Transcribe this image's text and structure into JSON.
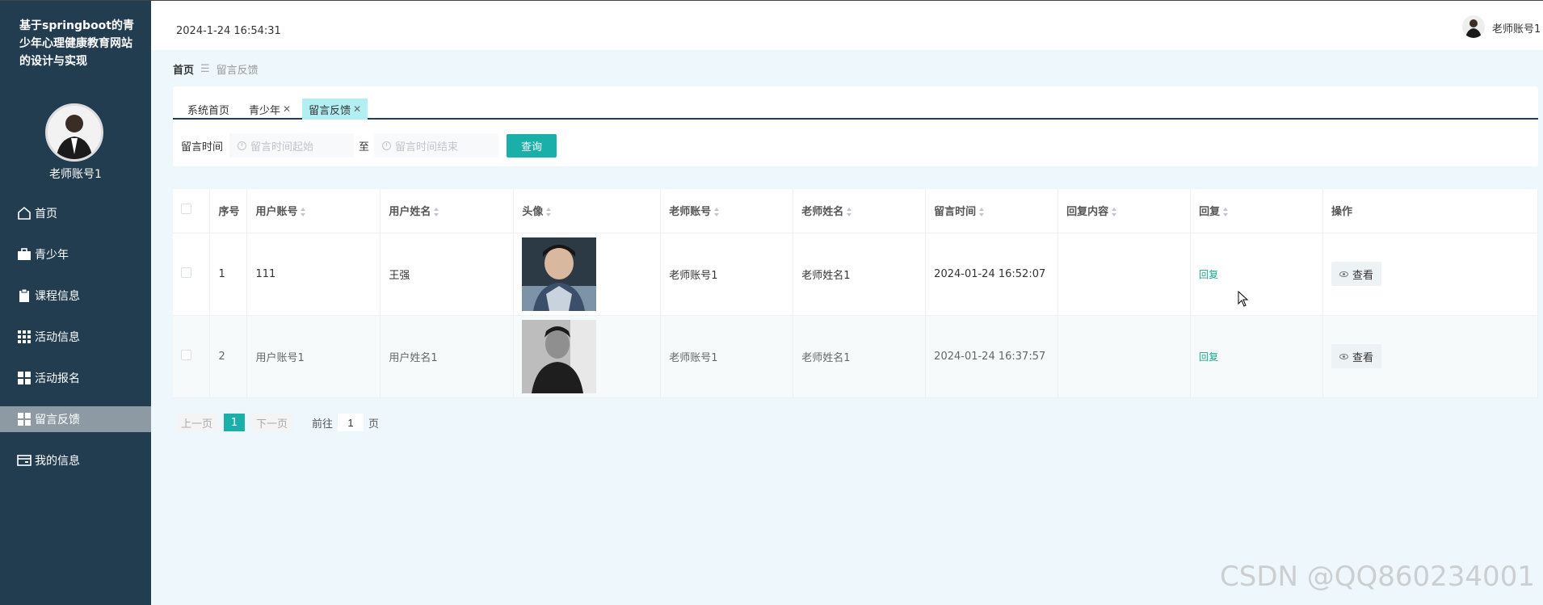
{
  "site": {
    "title": "基于springboot的青少年心理健康教育网站的设计与实现"
  },
  "profile": {
    "name": "老师账号1"
  },
  "menu": [
    {
      "label": "首页",
      "icon": "home-icon"
    },
    {
      "label": "青少年",
      "icon": "briefcase-icon"
    },
    {
      "label": "课程信息",
      "icon": "clipboard-icon"
    },
    {
      "label": "活动信息",
      "icon": "grid-icon"
    },
    {
      "label": "活动报名",
      "icon": "grid-four-icon"
    },
    {
      "label": "留言反馈",
      "icon": "grid-four-icon",
      "active": true
    },
    {
      "label": "我的信息",
      "icon": "card-icon"
    }
  ],
  "header": {
    "datetime": "2024-1-24 16:54:31",
    "user_name": "老师账号1"
  },
  "breadcrumb": {
    "home": "首页",
    "current": "留言反馈"
  },
  "tabs": [
    {
      "label": "系统首页",
      "closable": false
    },
    {
      "label": "青少年",
      "closable": true
    },
    {
      "label": "留言反馈",
      "closable": true,
      "active": true
    }
  ],
  "search": {
    "label": "留言时间",
    "start_placeholder": "留言时间起始",
    "range_separator": "至",
    "end_placeholder": "留言时间结束",
    "query_label": "查询"
  },
  "table": {
    "headers": [
      "序号",
      "用户账号",
      "用户姓名",
      "头像",
      "老师账号",
      "老师姓名",
      "留言时间",
      "回复内容",
      "回复",
      "操作"
    ],
    "rows": [
      {
        "index": "1",
        "user_account": "111",
        "user_name": "王强",
        "teacher_account": "老师账号1",
        "teacher_name": "老师姓名1",
        "time": "2024-01-24 16:52:07",
        "reply_content": "",
        "reply": "回复",
        "action": "查看"
      },
      {
        "index": "2",
        "user_account": "用户账号1",
        "user_name": "用户姓名1",
        "teacher_account": "老师账号1",
        "teacher_name": "老师姓名1",
        "time": "2024-01-24 16:37:57",
        "reply_content": "",
        "reply": "回复",
        "action": "查看"
      }
    ]
  },
  "pagination": {
    "prev": "上一页",
    "current": "1",
    "next": "下一页",
    "goto_label": "前往",
    "goto_value": "1",
    "unit": "页"
  },
  "watermark": "CSDN @QQ860234001",
  "colors": {
    "sidebar": "#223c50",
    "accent": "#1aafa8",
    "reply": "#1aa58c"
  }
}
